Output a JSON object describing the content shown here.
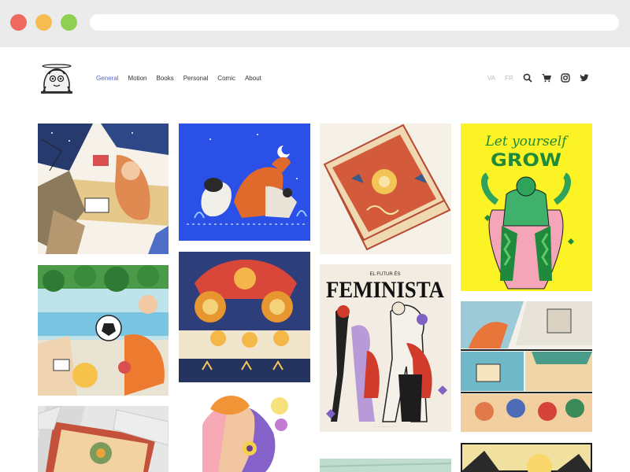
{
  "nav": {
    "items": [
      "General",
      "Motion",
      "Books",
      "Personal",
      "Comic",
      "About"
    ],
    "active": "General"
  },
  "lang": [
    "VA",
    "FR"
  ],
  "icons": [
    "search-icon",
    "cart-icon",
    "instagram-icon",
    "twitter-icon"
  ],
  "artworks": {
    "grow_line1": "Let yourself",
    "grow_line2": "GROW",
    "feminista_kicker": "EL FUTUR ÉS",
    "feminista_title": "FEMINISTA"
  },
  "colors": {
    "accent": "#5568d6",
    "dog_bg": "#2b50e8",
    "grow_bg": "#fbf326"
  }
}
